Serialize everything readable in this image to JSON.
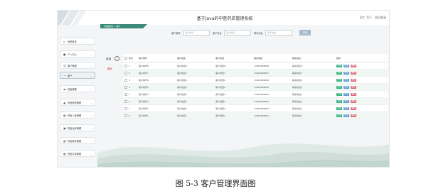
{
  "caption": "图 5-3 客户管理界面图",
  "app_title": "基于Java的中医药店管理系统",
  "user_bar": {
    "user": "员工 111",
    "logout": "退出登录"
  },
  "breadcrumb": "数据首页 > 客户",
  "sidebar": {
    "items": [
      {
        "icon": "home-icon",
        "glyph": "⌂",
        "label": "系统首页",
        "chevron": ""
      },
      {
        "icon": "user-icon",
        "glyph": "●",
        "label": "个人中心",
        "chevron": "⌄"
      },
      {
        "icon": "user-group-icon",
        "glyph": "☺",
        "label": "客户管理",
        "chevron": "⌄"
      },
      {
        "icon": "list-icon",
        "glyph": "—",
        "label": "客户",
        "chevron": "—",
        "active": true
      },
      {
        "icon": "bed-icon",
        "glyph": "▬",
        "label": "药品管理",
        "chevron": "⌄"
      },
      {
        "icon": "chart-icon",
        "glyph": "▲",
        "label": "药品采购管理",
        "chevron": "⌄"
      },
      {
        "icon": "grid-icon",
        "glyph": "▦",
        "label": "药品入库管理",
        "chevron": "⌄"
      },
      {
        "icon": "box-icon",
        "glyph": "▣",
        "label": "药品出库管理",
        "chevron": "⌄"
      },
      {
        "icon": "grid-icon",
        "glyph": "▦",
        "label": "药品库存管理",
        "chevron": "⌄"
      },
      {
        "icon": "grid-icon",
        "glyph": "▦",
        "label": "药品订单管理",
        "chevron": "⌄"
      }
    ]
  },
  "search": {
    "fields": [
      {
        "label": "客户编号",
        "placeholder": "客户编号"
      },
      {
        "label": "客户姓名",
        "placeholder": "客户姓名"
      },
      {
        "label": "联系地址",
        "placeholder": "联系地址"
      }
    ],
    "button": "查询"
  },
  "actions": {
    "add": "新增",
    "delete": "删除"
  },
  "table": {
    "headers": [
      "索引",
      "客户编号",
      "客户姓名",
      "客户类型",
      "联系电话",
      "联系地址",
      "操作"
    ],
    "op_labels": {
      "edit": "详情",
      "view": "修改",
      "delete": "删除"
    },
    "rows": [
      [
        "1",
        "客户编号8",
        "客户姓名8",
        "客户类型8",
        "13823888888",
        "联系地址8"
      ],
      [
        "2",
        "客户编号7",
        "客户姓名7",
        "客户类型7",
        "13823888887",
        "联系地址7"
      ],
      [
        "3",
        "客户编号6",
        "客户姓名6",
        "客户类型6",
        "13823888886",
        "联系地址6"
      ],
      [
        "4",
        "客户编号5",
        "客户姓名5",
        "客户类型5",
        "13823888885",
        "联系地址5"
      ],
      [
        "5",
        "客户编号4",
        "客户姓名4",
        "客户类型4",
        "13823888884",
        "联系地址4"
      ],
      [
        "6",
        "客户编号3",
        "客户姓名3",
        "客户类型3",
        "13823888883",
        "联系地址3"
      ],
      [
        "7",
        "客户编号2",
        "客户姓名2",
        "客户类型2",
        "13823888882",
        "联系地址2"
      ],
      [
        "8",
        "客户编号1",
        "客户姓名1",
        "客户类型1",
        "13823888881",
        "联系地址1"
      ]
    ]
  },
  "colors": {
    "accent_green": "#35b07e",
    "accent_blue": "#5b9bd5",
    "accent_red": "#e06b7c",
    "ribbon": "#3c8a78"
  }
}
